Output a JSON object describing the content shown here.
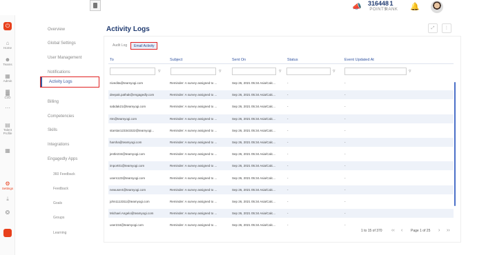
{
  "topbar": {
    "points_value": "316448",
    "points_label": "POINTS",
    "rank_value": "1",
    "rank_label": "RANK"
  },
  "rail": [
    {
      "label": "Home",
      "icon": "home-icon"
    },
    {
      "label": "Teams",
      "icon": "teams-icon"
    },
    {
      "label": "Admin",
      "icon": "admin-icon"
    },
    {
      "label": "CxO",
      "icon": "chart-icon"
    },
    {
      "label": "",
      "icon": "more-icon"
    },
    {
      "label": "Talent Profile",
      "icon": "talent-icon"
    },
    {
      "label": "",
      "icon": "grid-icon"
    },
    {
      "label": "Settings",
      "icon": "gear-icon"
    }
  ],
  "nav": {
    "items": [
      "Overview",
      "Global Settings",
      "User Management",
      "Notifications",
      "Activity Logs",
      "Billing",
      "Competencies",
      "Skills",
      "Integrations",
      "Engagedly Apps"
    ],
    "sub_items": [
      "360 Feedback",
      "Feedback",
      "Goals",
      "Groups",
      "Learning"
    ]
  },
  "page": {
    "title": "Activity Logs",
    "tabs": [
      "Audit Log",
      "Email Activity"
    ],
    "active_tab": "Email Activity"
  },
  "table": {
    "columns": [
      "To",
      "Subject",
      "Sent On",
      "Status",
      "Event Updated At"
    ],
    "rows": [
      [
        "nivedita@teamyogi.com",
        "Reminder: A survey assigned to ...",
        "Sep 26, 2021 05:34 Asia/Calc...",
        "-",
        "-"
      ],
      [
        "deepak.pathak@engagedly.com",
        "Reminder: A survey assigned to ...",
        "Sep 26, 2021 05:34 Asia/Calc...",
        "-",
        "-"
      ],
      [
        "sabdak21@teamyogi.com",
        "Reminder: A survey assigned to ...",
        "Sep 26, 2021 05:34 Asia/Calc...",
        "-",
        "-"
      ],
      [
        "rtm@teamyogi.com",
        "Reminder: A survey assigned to ...",
        "Sep 26, 2021 05:34 Asia/Calc...",
        "-",
        "-"
      ],
      [
        "starstar123343322@teamyogi...",
        "Reminder: A survey assigned to ...",
        "Sep 26, 2021 05:34 Asia/Calc...",
        "-",
        "-"
      ],
      [
        "harsha@teamyogi.com",
        "Reminder: A survey assigned to ...",
        "Sep 26, 2021 05:34 Asia/Calc...",
        "-",
        "-"
      ],
      [
        "jentle234@teamyogi.com",
        "Reminder: A survey assigned to ...",
        "Sep 26, 2021 05:34 Asia/Calc...",
        "-",
        "-"
      ],
      [
        "import01@teamyogi.com",
        "Reminder: A survey assigned to ...",
        "Sep 26, 2021 05:34 Asia/Calc...",
        "-",
        "-"
      ],
      [
        "users123@teamyogi.com",
        "Reminder: A survey assigned to ...",
        "Sep 26, 2021 05:34 Asia/Calc...",
        "-",
        "-"
      ],
      [
        "newuser4@teamyogi.com",
        "Reminder: A survey assigned to ...",
        "Sep 26, 2021 05:34 Asia/Calc...",
        "-",
        "-"
      ],
      [
        "john1113311@teamyogi.com",
        "Reminder: A survey assigned to ...",
        "Sep 26, 2021 05:34 Asia/Calc...",
        "-",
        "-"
      ],
      [
        "Michael.Angelo@teamyogi.com",
        "Reminder: A survey assigned to ...",
        "Sep 26, 2021 05:34 Asia/Calc...",
        "-",
        "-"
      ],
      [
        "user234@teamyogi.com",
        "Reminder: A survey assigned to ...",
        "Sep 26, 2021 05:34 Asia/Calc...",
        "-",
        "-"
      ]
    ]
  },
  "pagination": {
    "range": "1 to 15 of 370",
    "page": "Page 1 of 25"
  },
  "colors": {
    "accent": "#1f3a70",
    "brand": "#e8401c",
    "highlight": "#e02020"
  }
}
